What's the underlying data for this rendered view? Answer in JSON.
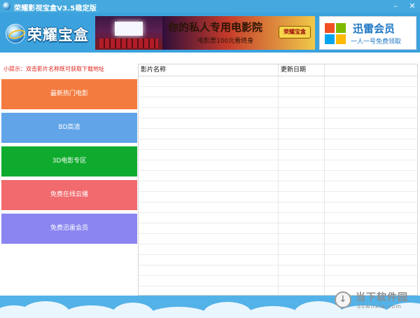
{
  "window": {
    "title": "荣耀影视宝盒V3.5稳定版",
    "minimize_icon": "minimize-icon",
    "close_icon": "close-icon",
    "minimize_glyph": "–",
    "close_glyph": "✕"
  },
  "header": {
    "logo_text": "荣耀宝盒",
    "banner1": {
      "main": "你的私人专用电影院",
      "sub": "电影票100元看终身",
      "badge": "荣耀宝盒"
    },
    "banner2": {
      "main": "迅雷会员",
      "sub": "一人一号免费领取"
    }
  },
  "sidebar": {
    "tip": "小提示：双击影片名称既可获取下载地址",
    "items": [
      {
        "label": "最新热门电影",
        "color": "#f47b3f"
      },
      {
        "label": "BD高清",
        "color": "#61a5e8"
      },
      {
        "label": "3D电影专区",
        "color": "#0fab2e"
      },
      {
        "label": "免费在线云播",
        "color": "#f06a6e"
      },
      {
        "label": "免费迅雷会员",
        "color": "#8a85f0"
      }
    ]
  },
  "table": {
    "columns": [
      "影片名称",
      "更新日期"
    ],
    "rows": []
  },
  "watermark": {
    "text": "当下软件园",
    "sub": "downxia.com"
  },
  "colors": {
    "titlebar": "#45a9df",
    "header": "#3ba2de",
    "footer": "#53b2e8"
  }
}
